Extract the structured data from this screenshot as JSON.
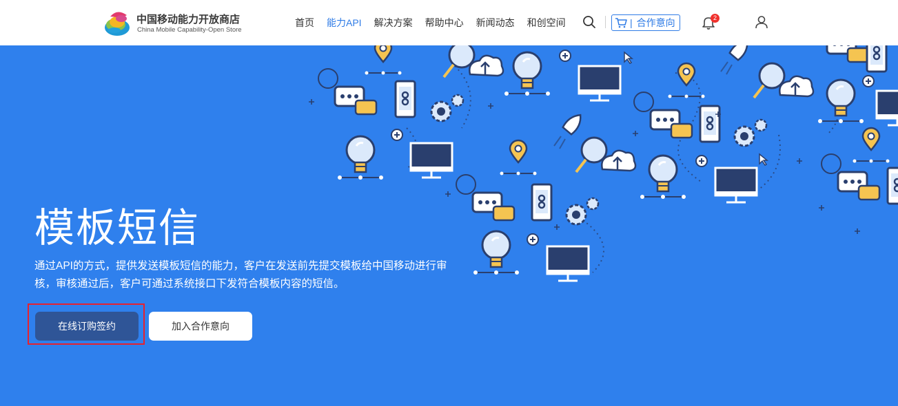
{
  "header": {
    "logo_cn": "中国移动能力开放商店",
    "logo_en": "China Mobile Capability-Open Store",
    "nav": [
      "首页",
      "能力API",
      "解决方案",
      "帮助中心",
      "新闻动态",
      "和创空间"
    ],
    "active_nav": "能力API",
    "coop_label": "合作意向",
    "coop_separator": "|",
    "notification_count": "2",
    "accent_color": "#2e7be6"
  },
  "hero": {
    "title": "模板短信",
    "description": "通过API的方式，提供发送模板短信的能力，客户在发送前先提交模板给中国移动进行审核，审核通过后，客户可通过系统接口下发符合模板内容的短信。",
    "primary_button": "在线订购签约",
    "secondary_button": "加入合作意向",
    "background_color": "#2f80ed",
    "primary_button_color": "#2f5597",
    "highlight_color": "#e8212d"
  },
  "icons": [
    "logo-icon",
    "search-icon",
    "cart-icon",
    "bell-icon",
    "user-icon",
    "lightbulb-icon",
    "monitor-icon",
    "phone-link-icon",
    "chat-bubble-icon",
    "gear-icon",
    "rocket-icon",
    "cloud-upload-icon",
    "location-pin-icon",
    "atom-icon",
    "cursor-icon",
    "magnifier-icon"
  ]
}
